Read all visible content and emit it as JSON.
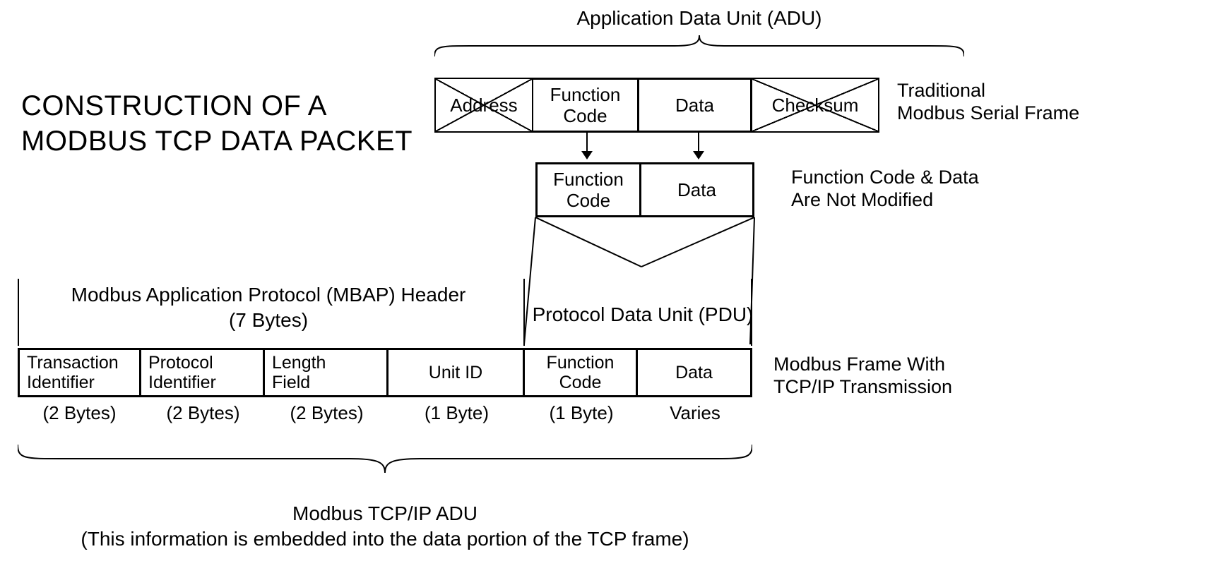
{
  "title_line1": "CONSTRUCTION OF A",
  "title_line2": "MODBUS TCP DATA PACKET",
  "adu_label": "Application Data Unit (ADU)",
  "serial_frame": {
    "cells": [
      "Address",
      "Function\nCode",
      "Data",
      "Checksum"
    ],
    "note": "Traditional\nModbus Serial Frame"
  },
  "unmodified": {
    "cells": [
      "Function\nCode",
      "Data"
    ],
    "note": "Function Code & Data\nAre Not Modified"
  },
  "mbap_header": "Modbus Application Protocol (MBAP) Header\n(7 Bytes)",
  "pdu_header": "Protocol Data Unit (PDU)",
  "tcp_frame": {
    "cells": [
      "Transaction\nIdentifier",
      "Protocol\nIdentifier",
      "Length\nField",
      "Unit ID",
      "Function\nCode",
      "Data"
    ],
    "bytes": [
      "(2 Bytes)",
      "(2 Bytes)",
      "(2 Bytes)",
      "(1 Byte)",
      "(1 Byte)",
      "Varies"
    ],
    "note": "Modbus Frame With\nTCP/IP Transmission"
  },
  "bottom_label1": "Modbus TCP/IP ADU",
  "bottom_label2": "(This information is embedded into the data portion of the TCP frame)"
}
